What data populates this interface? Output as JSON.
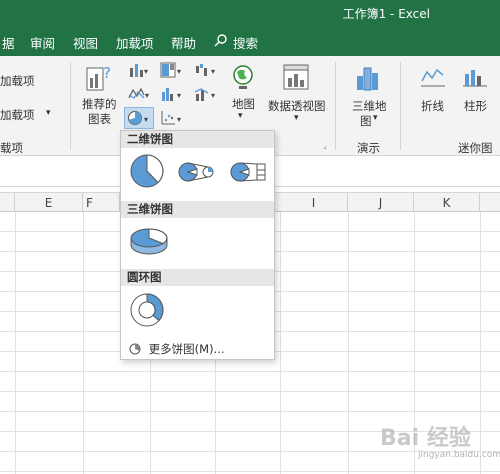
{
  "window": {
    "title": "工作簿1 - Excel"
  },
  "menu": [
    "据",
    "审阅",
    "视图",
    "加载项",
    "帮助",
    "搜索"
  ],
  "ribbon": {
    "addins_labels": [
      "加载项",
      "加载项"
    ],
    "addins_group": "载项",
    "recommended_charts_line1": "推荐的",
    "recommended_charts_line2": "图表",
    "maps_label": "地图",
    "pivot_chart_label": "数据透视图",
    "map3d_line1": "三维地",
    "map3d_line2": "图",
    "tours_group": "演示",
    "line_label": "折线",
    "column_label": "柱形",
    "sparklines_group": "迷你图"
  },
  "columns": [
    "E",
    "F",
    "I",
    "J",
    "K"
  ],
  "dropdown": {
    "section_2d": "二维饼图",
    "section_3d": "三维饼图",
    "section_doughnut": "圆环图",
    "more_label": "更多饼图(M)...",
    "icons": [
      "pie-icon",
      "pie-of-pie-icon",
      "bar-of-pie-icon",
      "pie-3d-icon",
      "doughnut-icon"
    ]
  },
  "colors": {
    "excel_green": "#217346",
    "chart_blue": "#5b9bd5"
  },
  "watermark": {
    "main": "Bai 经验",
    "sub": "jingyan.baidu.com"
  }
}
